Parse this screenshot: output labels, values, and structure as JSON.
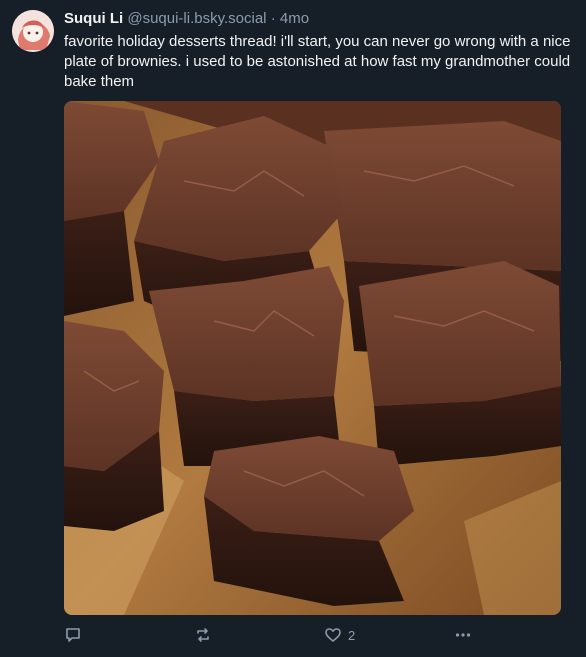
{
  "post": {
    "author": {
      "display_name": "Suqui Li",
      "handle": "@suqui-li.bsky.social",
      "separator": "·",
      "timestamp": "4mo"
    },
    "text": "favorite holiday desserts thread! i'll start, you can never go wrong with a nice plate of brownies. i used to be astonished at how fast my grandmother could bake them",
    "image": {
      "subject": "plate of brownies"
    },
    "actions": {
      "reply_icon": "reply-icon",
      "repost_icon": "repost-icon",
      "like_icon": "heart-icon",
      "like_count": "2",
      "more_icon": "more-icon"
    }
  },
  "colors": {
    "background": "#161e27",
    "text_primary": "#f1f3f5",
    "text_secondary": "#8c9cae"
  }
}
